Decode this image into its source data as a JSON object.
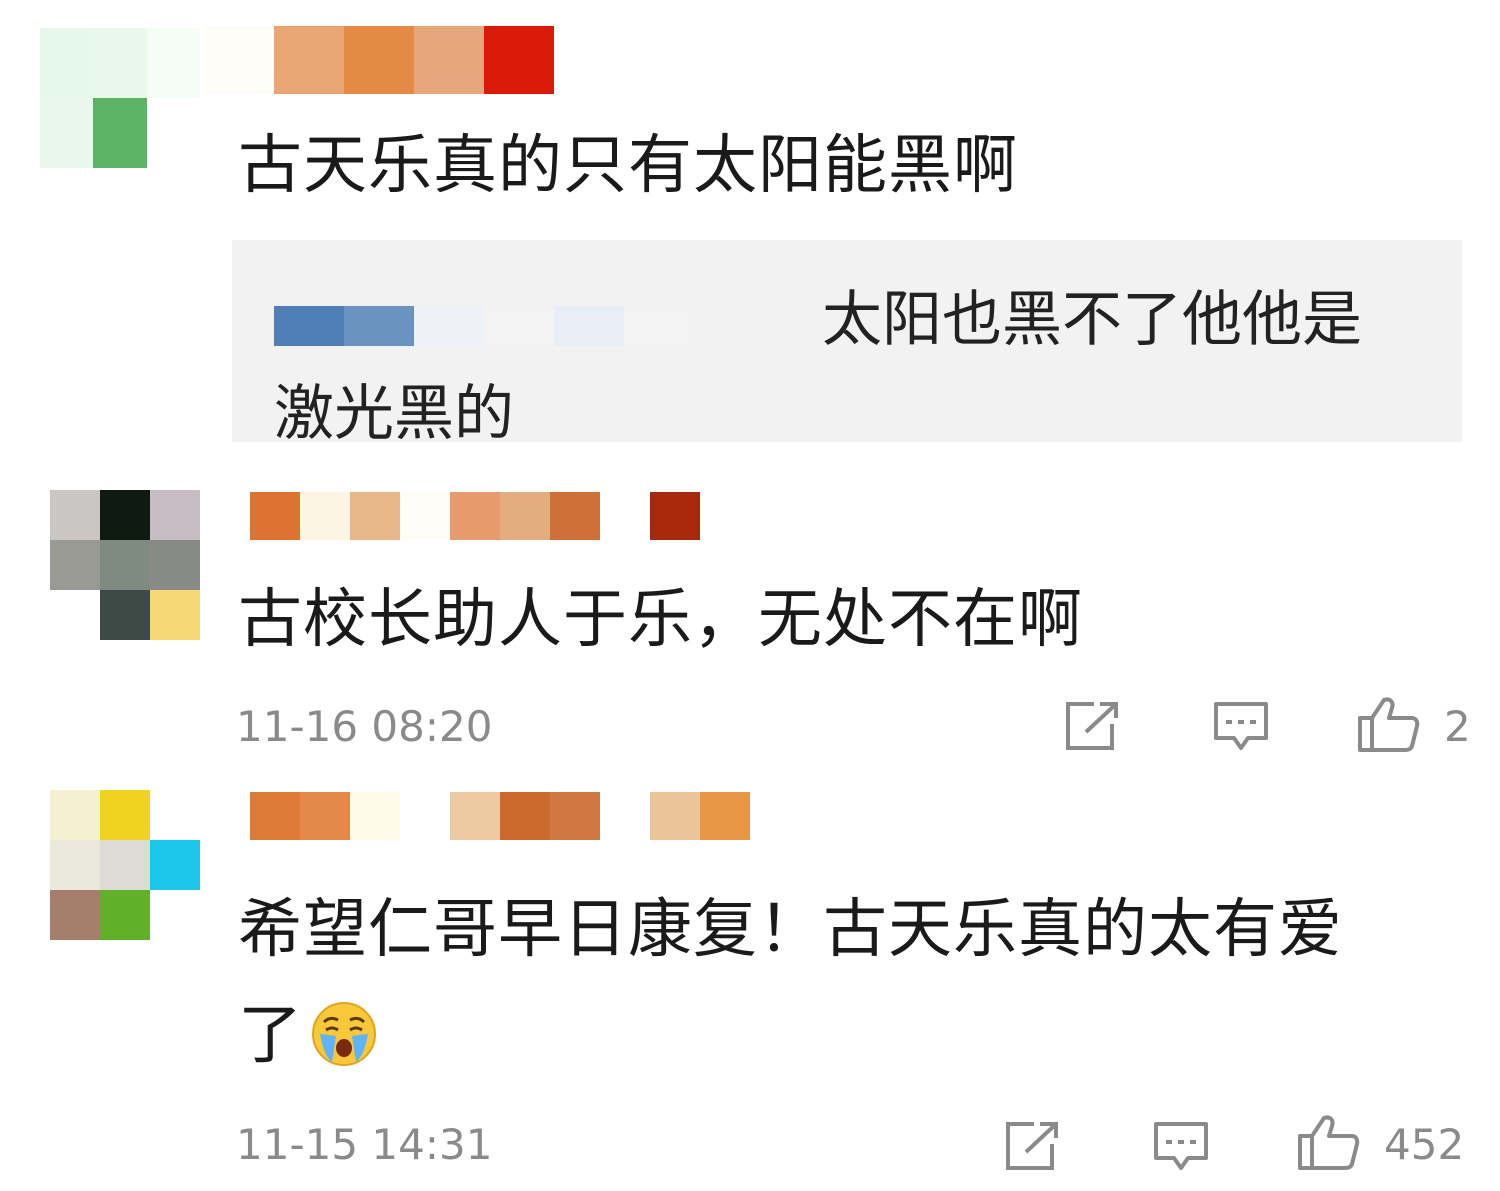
{
  "comments": [
    {
      "text": "古天乐真的只有太阳能黑啊",
      "reply": {
        "text_line1": "太阳也黑不了他他是",
        "text_line2": "激光黑的"
      }
    },
    {
      "text": "古校长助人于乐，无处不在啊",
      "timestamp": "11-16 08:20",
      "likes": "2"
    },
    {
      "text_line1": "希望仁哥早日康复！古天乐真的太有爱",
      "text_line2": "了",
      "emoji": "crying-face",
      "timestamp": "11-15 14:31",
      "likes": "452"
    }
  ],
  "icons": [
    "share-icon",
    "reply-icon",
    "like-icon"
  ],
  "colors": {
    "reply_bg": "#f2f2f2",
    "meta_text": "#8a8a8a",
    "content_text": "#1a1a1a"
  }
}
